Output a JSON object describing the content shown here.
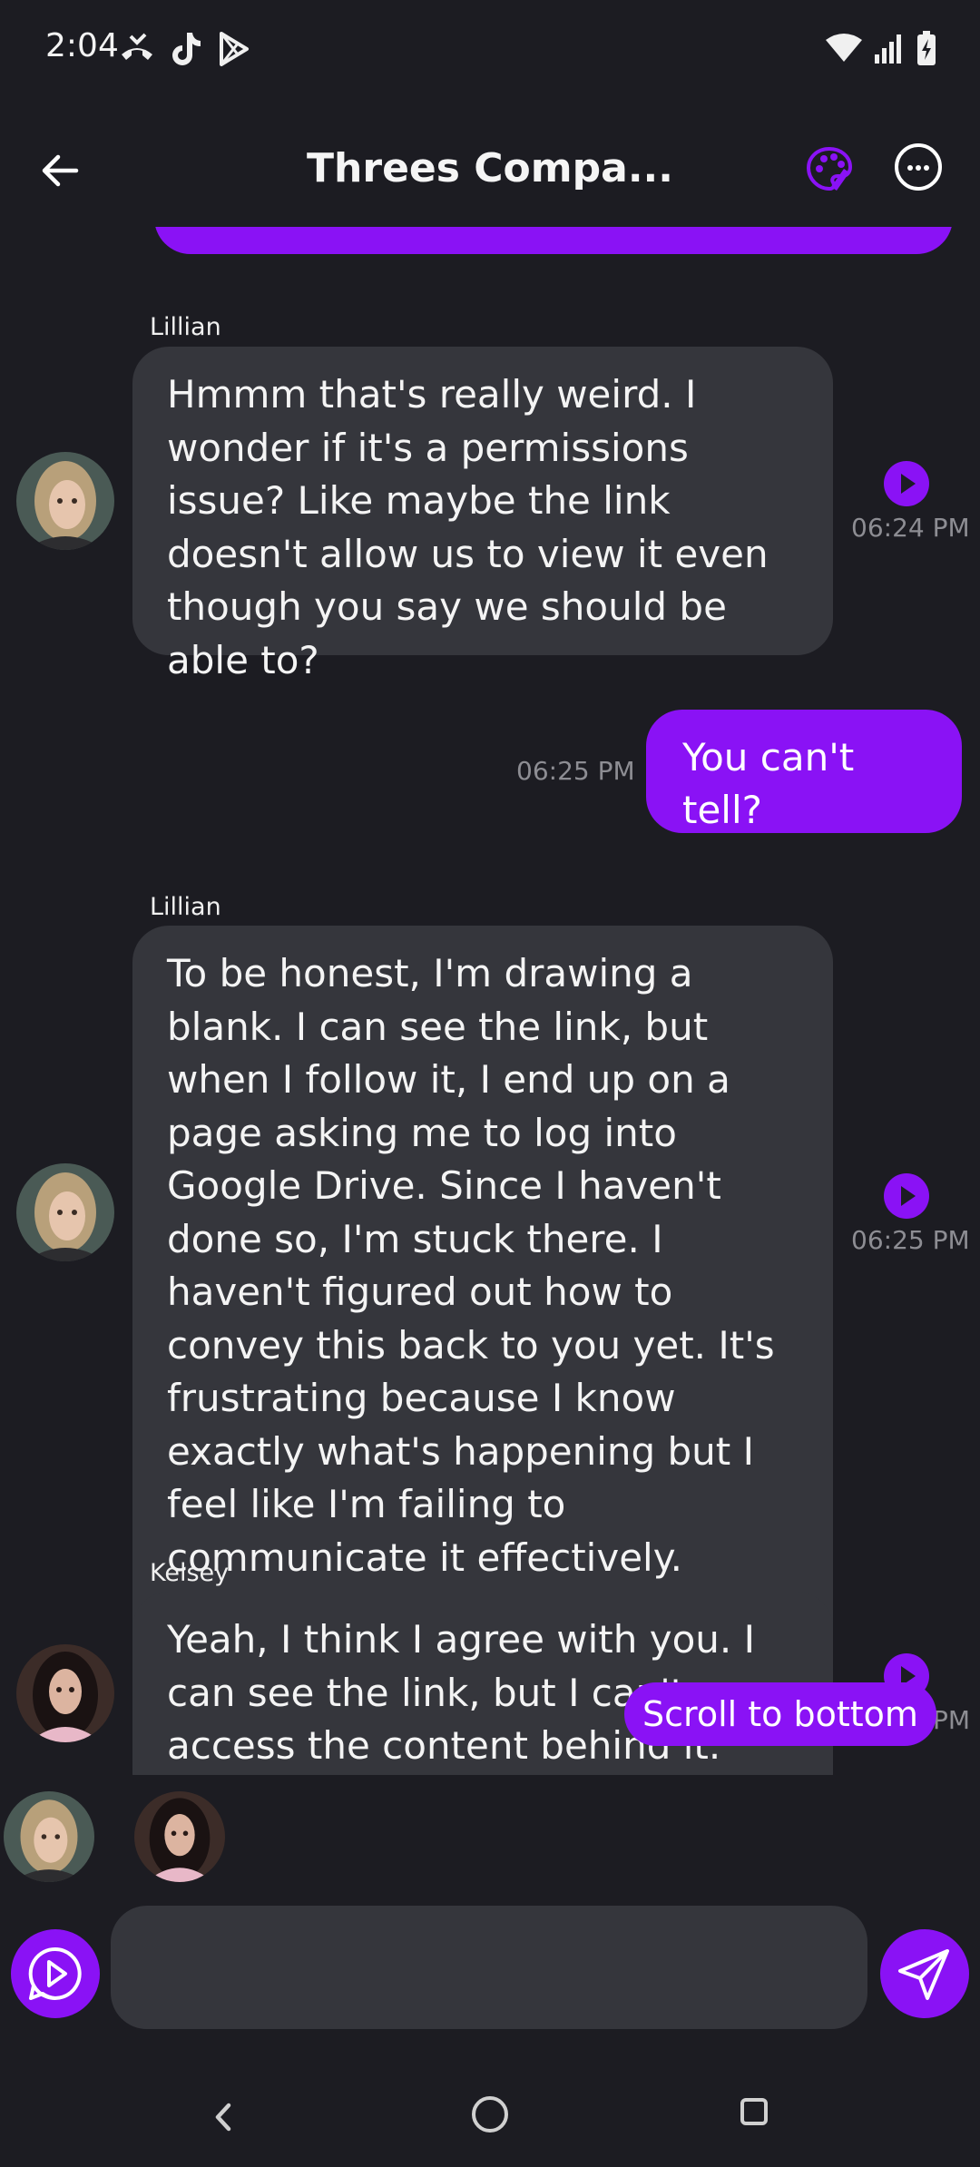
{
  "status_bar": {
    "time": "2:04",
    "icons_left": [
      "missed-call-icon",
      "tiktok-icon",
      "play-store-icon"
    ],
    "icons_right": [
      "wifi-icon",
      "signal-icon",
      "battery-charging-icon"
    ]
  },
  "header": {
    "title": "Threes Compa...",
    "accent_color": "#8a12f5"
  },
  "messages": [
    {
      "sender": "Lillian",
      "text": "Hmmm that's really weird. I wonder if it's a permissions issue? Like maybe the link doesn't allow us to view it even though you say we should be able to?",
      "time": "06:24 PM",
      "direction": "incoming"
    },
    {
      "text": "You can't tell?",
      "time": "06:25 PM",
      "direction": "outgoing"
    },
    {
      "sender": "Lillian",
      "text": "To be honest, I'm drawing a blank. I can see the link, but when I follow it, I end up on a page asking me to log into Google Drive. Since I haven't done so, I'm stuck there. I haven't figured out how to convey this back to you yet. It's frustrating because I know exactly what's happening but I feel like I'm failing to communicate it effectively.",
      "time": "06:25 PM",
      "direction": "incoming"
    },
    {
      "sender": "Kelsey",
      "text": "Yeah, I think I agree with you. I can see the link, but I can't access the content behind it.",
      "time": "PM",
      "direction": "incoming"
    }
  ],
  "scroll_button": "Scroll to bottom",
  "composer": {
    "placeholder": ""
  },
  "colors": {
    "background": "#1c1c22",
    "bubble_incoming": "#35363c",
    "bubble_outgoing": "#8a12f5"
  }
}
